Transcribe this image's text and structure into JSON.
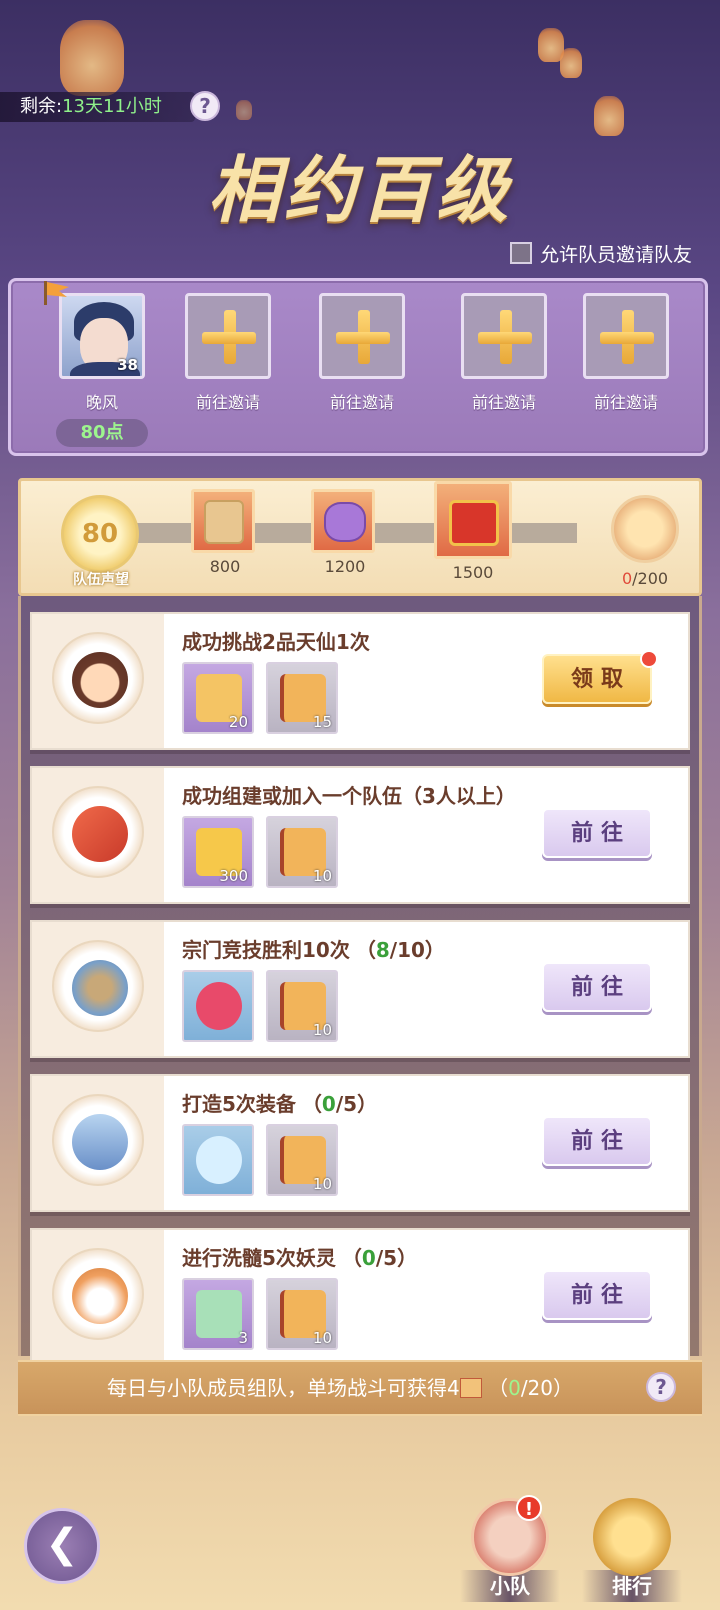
{
  "timer": {
    "label": "剩余:",
    "value": "13天11小时"
  },
  "help_glyph": "?",
  "event_title": "相约百级",
  "allow_invite_label": "允许队员邀请队友",
  "team": {
    "leader": {
      "name": "晚风",
      "level": "38",
      "points": "80点"
    },
    "invite_slots": [
      {
        "label": "前往邀请"
      },
      {
        "label": "前往邀请"
      },
      {
        "label": "前往邀请"
      },
      {
        "label": "前往邀请"
      }
    ]
  },
  "reputation": {
    "value": "80",
    "label": "队伍声望",
    "milestones": [
      {
        "value": "800",
        "icon": "golden-scroll-icon"
      },
      {
        "value": "1200",
        "icon": "purple-pouch-icon"
      },
      {
        "value": "1500",
        "icon": "red-gift-chest-icon"
      }
    ],
    "final": {
      "current": "0",
      "total": "/200",
      "icon": "golden-chest-icon"
    }
  },
  "tasks": [
    {
      "title": "成功挑战2品天仙1次",
      "progress": null,
      "icon": "demon-child-face-icon",
      "rewards": [
        {
          "count": "20",
          "style": "purple",
          "icon": "sword-token-icon"
        },
        {
          "count": "15",
          "style": "grey",
          "icon": "team-flag-scroll-icon"
        }
      ],
      "button": "领取",
      "button_type": "claim",
      "red_dot": true
    },
    {
      "title": "成功组建或加入一个队伍（3人以上）",
      "progress": null,
      "icon": "red-flag-icon",
      "rewards": [
        {
          "count": "300",
          "style": "purple",
          "icon": "gold-ingot-icon"
        },
        {
          "count": "10",
          "style": "grey",
          "icon": "team-flag-scroll-icon"
        }
      ],
      "button": "前往",
      "button_type": "go",
      "red_dot": false
    },
    {
      "title": "宗门竞技胜利10次",
      "progress": {
        "open": "（",
        "current": "8",
        "total": "/10",
        "close": "）"
      },
      "icon": "arena-icon",
      "rewards": [
        {
          "count": "",
          "style": "blue",
          "icon": "red-gem-icon"
        },
        {
          "count": "10",
          "style": "grey",
          "icon": "team-flag-scroll-icon"
        }
      ],
      "button": "前往",
      "button_type": "go",
      "red_dot": false
    },
    {
      "title": "打造5次装备",
      "progress": {
        "open": "（",
        "current": "0",
        "total": "/5",
        "close": "）"
      },
      "icon": "armor-icon",
      "rewards": [
        {
          "count": "",
          "style": "blue",
          "icon": "blue-orb-icon"
        },
        {
          "count": "10",
          "style": "grey",
          "icon": "team-flag-scroll-icon"
        }
      ],
      "button": "前往",
      "button_type": "go",
      "red_dot": false
    },
    {
      "title": "进行洗髓5次妖灵",
      "progress": {
        "open": "（",
        "current": "0",
        "total": "/5",
        "close": "）"
      },
      "icon": "fox-spirit-icon",
      "rewards": [
        {
          "count": "3",
          "style": "purple",
          "icon": "spirit-fruit-icon"
        },
        {
          "count": "10",
          "style": "grey",
          "icon": "team-flag-scroll-icon"
        }
      ],
      "button": "前往",
      "button_type": "go",
      "red_dot": false
    }
  ],
  "daily_info": {
    "text": "每日与小队成员组队，单场战斗可获得4",
    "open": "（",
    "current": "0",
    "total": "/20",
    "close": "）"
  },
  "nav": {
    "team_label": "小队",
    "team_alert": "!",
    "rank_label": "排行"
  },
  "colors": {
    "accent_green": "#9df58e",
    "progress_green": "#3aa03a",
    "alert_red": "#e83a2a",
    "title_gold": "#f8e2a8"
  }
}
